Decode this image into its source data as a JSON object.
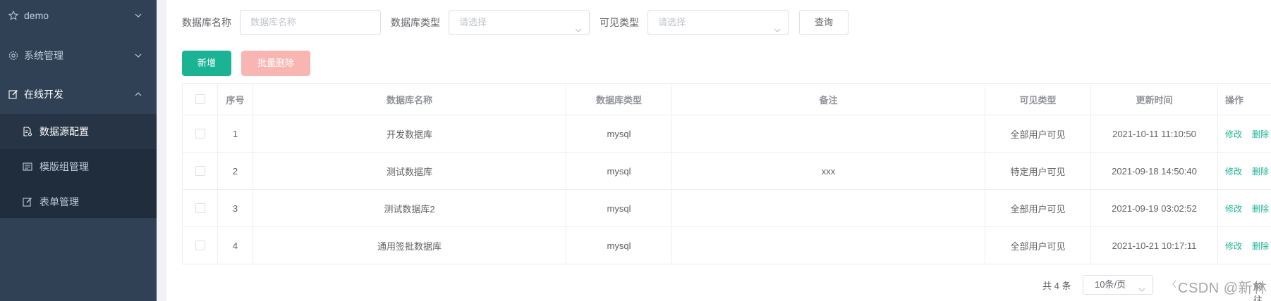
{
  "sidebar": {
    "items": [
      {
        "label": "demo",
        "icon": "star-icon"
      },
      {
        "label": "系统管理",
        "icon": "gear-icon"
      },
      {
        "label": "在线开发",
        "icon": "edit-icon"
      }
    ],
    "submenu": [
      {
        "label": "数据源配置",
        "icon": "document-settings-icon"
      },
      {
        "label": "模版组管理",
        "icon": "template-icon"
      },
      {
        "label": "表单管理",
        "icon": "edit-icon"
      }
    ]
  },
  "filters": {
    "db_name_label": "数据库名称",
    "db_name_placeholder": "数据库名称",
    "db_type_label": "数据库类型",
    "db_type_placeholder": "请选择",
    "visibility_label": "可见类型",
    "visibility_placeholder": "请选择",
    "query_label": "查询"
  },
  "actions": {
    "add_label": "新增",
    "batch_delete_label": "批量删除"
  },
  "table": {
    "headers": {
      "index": "序号",
      "name": "数据库名称",
      "type": "数据库类型",
      "remark": "备注",
      "visibility": "可见类型",
      "updated": "更新时间",
      "ops": "操作"
    },
    "rows": [
      {
        "index": "1",
        "name": "开发数据库",
        "type": "mysql",
        "remark": "",
        "visibility": "全部用户可见",
        "updated": "2021-10-11 11:10:50",
        "edit": "修改",
        "delete": "删除"
      },
      {
        "index": "2",
        "name": "测试数据库",
        "type": "mysql",
        "remark": "xxx",
        "visibility": "特定用户可见",
        "updated": "2021-09-18 14:50:40",
        "edit": "修改",
        "delete": "删除"
      },
      {
        "index": "3",
        "name": "测试数据库2",
        "type": "mysql",
        "remark": "",
        "visibility": "全部用户可见",
        "updated": "2021-09-19 03:02:52",
        "edit": "修改",
        "delete": "删除"
      },
      {
        "index": "4",
        "name": "通用签批数据库",
        "type": "mysql",
        "remark": "",
        "visibility": "全部用户可见",
        "updated": "2021-10-21 10:17:11",
        "edit": "修改",
        "delete": "删除"
      }
    ]
  },
  "pagination": {
    "total": "共 4 条",
    "page_size": "10条/页",
    "goto": "前往"
  },
  "watermark": "CSDN @新林",
  "colors": {
    "sidebar_bg": "#304156",
    "submenu_bg": "#1f2d3d",
    "primary": "#1ab394",
    "danger_light": "#f8b6b3"
  }
}
